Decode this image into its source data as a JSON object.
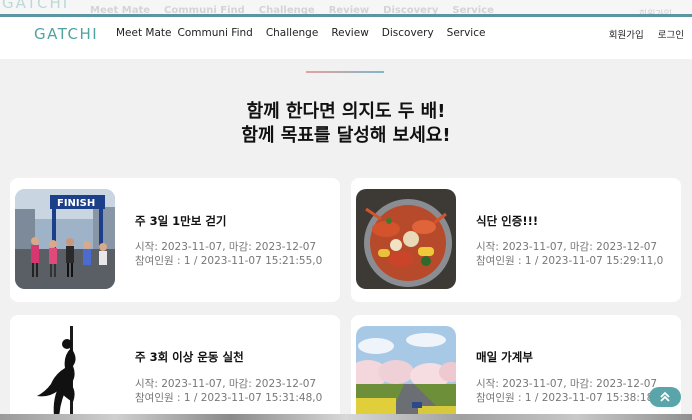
{
  "ghost": {
    "logo": "GATCHI",
    "nav": [
      "Meet Mate",
      "Communi Find",
      "Challenge",
      "Review",
      "Discovery",
      "Service"
    ],
    "login": "회원가입"
  },
  "header": {
    "logo": "GATCHI",
    "nav": [
      "Meet Mate",
      "Communi Find",
      "Challenge",
      "Review",
      "Discovery",
      "Service"
    ],
    "signup": "회원가입",
    "login": "로그인"
  },
  "headline": {
    "line1": "함께 한다면 의지도 두 배!",
    "line2": "함께 목표를 달성해 보세요!"
  },
  "cards": [
    {
      "title": "주 3일 1만보 걷기",
      "dates": "시작: 2023-11-07, 마감: 2023-12-07",
      "participants": "참여인원 : 1 / 2023-11-07 15:21:55,0",
      "image": "marathon-finish-photo"
    },
    {
      "title": "식단 인증!!!",
      "dates": "시작: 2023-11-07, 마감: 2023-12-07",
      "participants": "참여인원 : 1 / 2023-11-07 15:29:11,0",
      "image": "seafood-boil-photo"
    },
    {
      "title": "주 3회 이상 운동 실천",
      "dates": "시작: 2023-11-07, 마감: 2023-12-07",
      "participants": "참여인원 : 1 / 2023-11-07 15:31:48,0",
      "image": "pole-dance-silhouette-photo"
    },
    {
      "title": "매일 가계부",
      "dates": "시작: 2023-11-07, 마감: 2023-12-07",
      "participants": "참여인원 : 1 / 2023-11-07 15:38:18,0",
      "image": "cherry-blossom-road-photo"
    }
  ],
  "colors": {
    "accent": "#4fa3a0",
    "topline": "#5b95a3",
    "button": "#5aa5aa"
  },
  "icons": {
    "scroll_top": "double-chevron-up-icon"
  }
}
